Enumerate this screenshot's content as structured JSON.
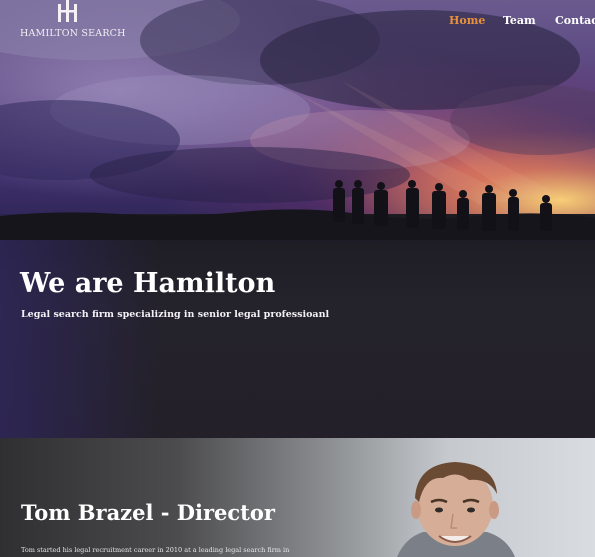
{
  "brand": {
    "name": "HAMILTON SEARCH"
  },
  "nav": {
    "items": [
      {
        "label": "Home",
        "active": true
      },
      {
        "label": "Team",
        "active": false
      },
      {
        "label": "Contact",
        "active": false
      }
    ],
    "active_color": "#e8903c"
  },
  "hero": {
    "title": "We are Hamilton",
    "subtitle": "Legal search firm specializing in senior legal professioanl"
  },
  "director": {
    "title": "Tom Brazel - Director",
    "bio": "Tom started his legal recruitment career in 2010 at a leading legal search firm in"
  }
}
